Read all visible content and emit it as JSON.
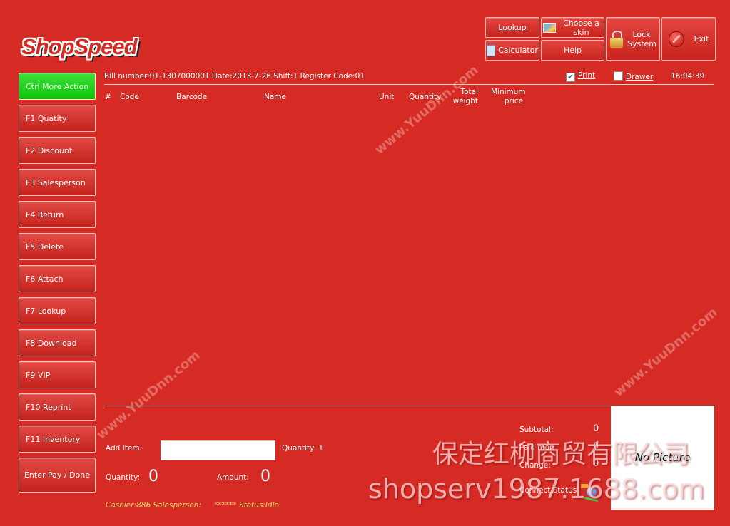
{
  "app": {
    "logo_text": "ShopSpeed"
  },
  "toolbar": {
    "lookup": "Lookup",
    "choose_skin": "Choose a skin",
    "calculator": "Calculator",
    "help": "Help",
    "lock_system": "Lock System",
    "exit": "Exit"
  },
  "sidebar": {
    "items": [
      {
        "label": "Ctrl More Action"
      },
      {
        "label": "F1 Quatity"
      },
      {
        "label": "F2 Discount"
      },
      {
        "label": "F3 Salesperson"
      },
      {
        "label": "F4 Return"
      },
      {
        "label": "F5 Delete"
      },
      {
        "label": "F6 Attach"
      },
      {
        "label": "F7 Lookup"
      },
      {
        "label": "F8 Download"
      },
      {
        "label": "F9 VIP"
      },
      {
        "label": "F10 Reprint"
      },
      {
        "label": "F11 Inventory"
      },
      {
        "label": "Enter Pay / Done"
      }
    ]
  },
  "bill": {
    "info": "Bill number:01-1307000001  Date:2013-7-26  Shift:1 Register Code:01",
    "print_label": "Print",
    "print_checked": true,
    "drawer_label": "Drawer",
    "drawer_checked": false,
    "time": "16:04:39"
  },
  "table": {
    "columns": [
      "#",
      "Code",
      "Barcode",
      "Name",
      "Unit",
      "Quantity",
      "Total weight",
      "Minimum price"
    ],
    "rows": []
  },
  "bottom": {
    "add_item_label": "Add Item:",
    "add_item_value": "",
    "quantity_input_label": "Quantity: 1",
    "quantity_label": "Quantity:",
    "quantity_value": "0",
    "amount_label": "Amount:",
    "amount_value": "0",
    "cashier": "Cashier:886 Salesperson:",
    "status": "****** Status:Idle",
    "subtotal_label": "Subtotal:",
    "subtotal_value": "0",
    "paid_label": "Paid mon",
    "paid_value": "0",
    "change_label": "Change:",
    "change_value": "0",
    "connect_status_label": "Connect Status",
    "no_picture": "No Picture"
  },
  "watermarks": {
    "site": "www.YuuDnn.com",
    "company": "保定红柳商贸有限公司",
    "url": "shopserv1987.1688.com"
  },
  "colors": {
    "background": "#d62b24",
    "accent_green": "#1fd11b"
  }
}
